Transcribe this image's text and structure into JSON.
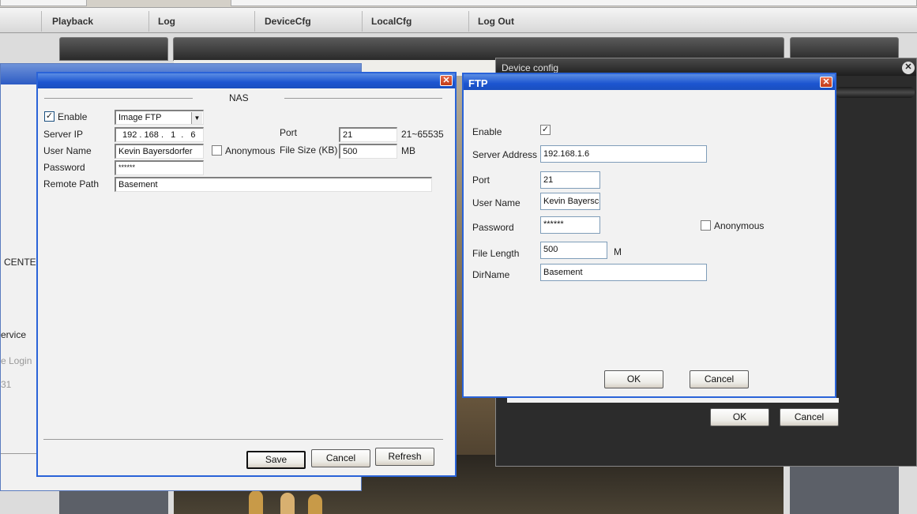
{
  "menu": {
    "items": [
      "Playback",
      "Log",
      "DeviceCfg",
      "LocalCfg",
      "Log Out"
    ]
  },
  "left_window": {
    "fragments": [
      "CENTER",
      "ervice",
      "e Login",
      "31"
    ]
  },
  "nas_dialog": {
    "group_title": "NAS",
    "enable_label": "Enable",
    "enable_checked": "✓",
    "protocol_value": "Image FTP",
    "server_ip_label": "Server IP",
    "server_ip": [
      "192",
      "168",
      "1",
      "6"
    ],
    "port_label": "Port",
    "port_value": "21",
    "port_range": "21~65535",
    "user_name_label": "User Name",
    "user_name_value": "Kevin Bayersdorfer",
    "anonymous_label": "Anonymous",
    "file_size_label": "File Size (KB)",
    "file_size_value": "500",
    "file_size_unit": "MB",
    "password_label": "Password",
    "password_value": "******",
    "remote_path_label": "Remote Path",
    "remote_path_value": "Basement",
    "save_label": "Save",
    "cancel_label": "Cancel",
    "refresh_label": "Refresh"
  },
  "device_config": {
    "title": "Device config",
    "ok_label": "OK",
    "cancel_label": "Cancel"
  },
  "ftp_dialog": {
    "title": "FTP",
    "enable_label": "Enable",
    "enable_checked": "✓",
    "server_address_label": "Server Address",
    "server_address_value": "192.168.1.6",
    "port_label": "Port",
    "port_value": "21",
    "user_name_label": "User Name",
    "user_name_value": "Kevin Bayersc",
    "password_label": "Password",
    "password_value": "******",
    "anonymous_label": "Anonymous",
    "file_length_label": "File Length",
    "file_length_value": "500",
    "file_length_unit": "M",
    "dirname_label": "DirName",
    "dirname_value": "Basement",
    "ok_label": "OK",
    "cancel_label": "Cancel"
  },
  "colors": {
    "title_blue": "#1c55d0",
    "dialog_bg": "#f2f2f2",
    "dark_panel": "#2c2c2c"
  }
}
